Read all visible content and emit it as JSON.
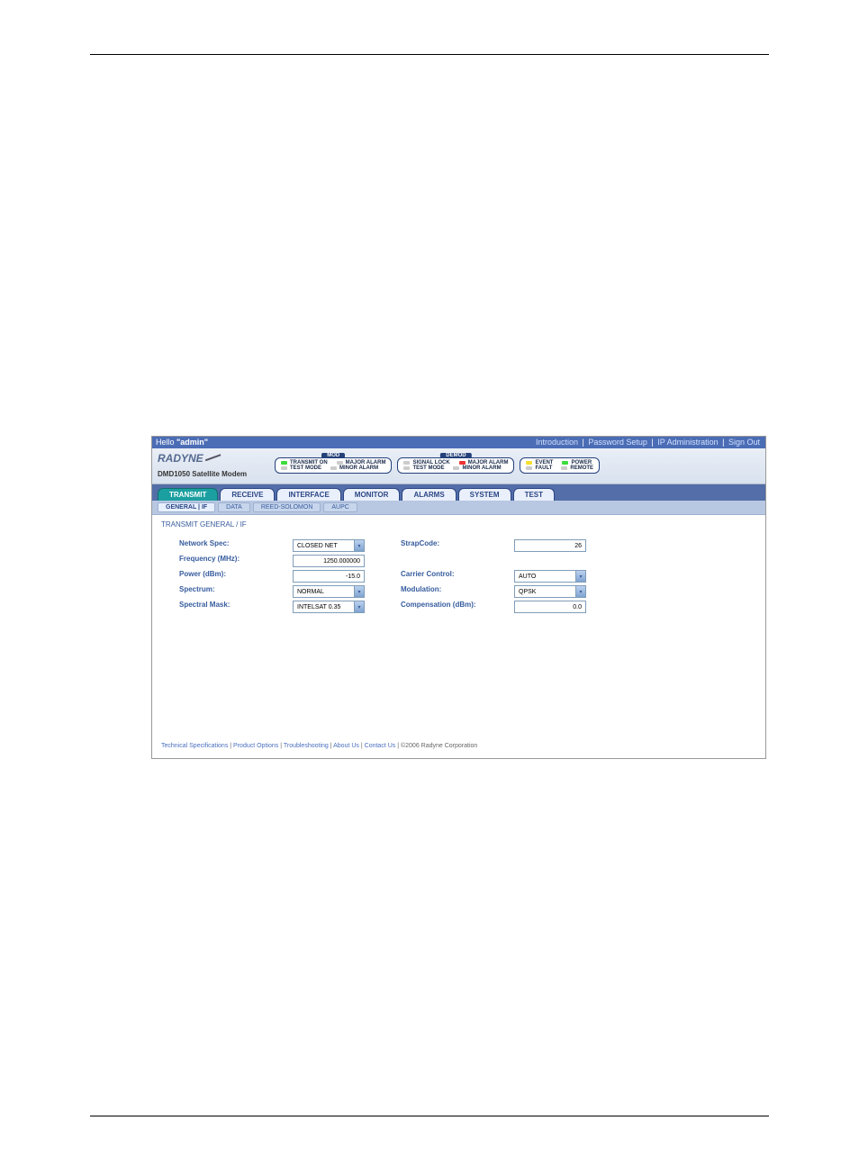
{
  "top": {
    "greeting_prefix": "Hello ",
    "greeting_user": "\"admin\"",
    "links": [
      "Introduction",
      "Password Setup",
      "IP Administration",
      "Sign Out"
    ]
  },
  "logo": {
    "brand": "RADYNE",
    "device": "DMD1050 Satellite Modem"
  },
  "status": {
    "mod": {
      "title": "MOD",
      "items": [
        {
          "label": "TRANSMIT ON",
          "led": "g"
        },
        {
          "label": "MAJOR ALARM",
          "led": "off"
        },
        {
          "label": "TEST MODE",
          "led": "off"
        },
        {
          "label": "MINOR ALARM",
          "led": "off"
        }
      ]
    },
    "demod": {
      "title": "DEMOD",
      "items": [
        {
          "label": "SIGNAL LOCK",
          "led": "off"
        },
        {
          "label": "MAJOR ALARM",
          "led": "r"
        },
        {
          "label": "TEST MODE",
          "led": "off"
        },
        {
          "label": "MINOR ALARM",
          "led": "off"
        }
      ]
    },
    "sys": {
      "items": [
        {
          "label": "EVENT",
          "led": "y"
        },
        {
          "label": "POWER",
          "led": "g"
        },
        {
          "label": "FAULT",
          "led": "off"
        },
        {
          "label": "REMOTE",
          "led": "off"
        }
      ]
    }
  },
  "tabs": [
    "TRANSMIT",
    "RECEIVE",
    "INTERFACE",
    "MONITOR",
    "ALARMS",
    "SYSTEM",
    "TEST"
  ],
  "active_tab": "TRANSMIT",
  "subtabs": [
    "GENERAL | IF",
    "DATA",
    "REED-SOLOMON",
    "AUPC"
  ],
  "active_subtab": "GENERAL | IF",
  "panel_head": "TRANSMIT GENERAL / IF",
  "fields_left": [
    {
      "label": "Network Spec:",
      "type": "sel",
      "value": "CLOSED NET"
    },
    {
      "label": "Frequency (MHz):",
      "type": "txt",
      "value": "1250.000000"
    },
    {
      "label": "Power (dBm):",
      "type": "txt",
      "value": "-15.0"
    },
    {
      "label": "Spectrum:",
      "type": "sel",
      "value": "NORMAL"
    },
    {
      "label": "Spectral Mask:",
      "type": "sel",
      "value": "INTELSAT 0.35"
    }
  ],
  "fields_right": [
    {
      "label": "StrapCode:",
      "type": "txt",
      "value": "26"
    },
    {
      "label": "",
      "type": "gap",
      "value": ""
    },
    {
      "label": "Carrier Control:",
      "type": "sel",
      "value": "AUTO"
    },
    {
      "label": "Modulation:",
      "type": "sel",
      "value": "QPSK"
    },
    {
      "label": "Compensation (dBm):",
      "type": "txt",
      "value": "0.0"
    }
  ],
  "footer": {
    "links": [
      "Technical Specifications",
      "Product Options",
      "Troubleshooting",
      "About Us",
      "Contact Us"
    ],
    "copyright": "©2006 Radyne Corporation"
  }
}
